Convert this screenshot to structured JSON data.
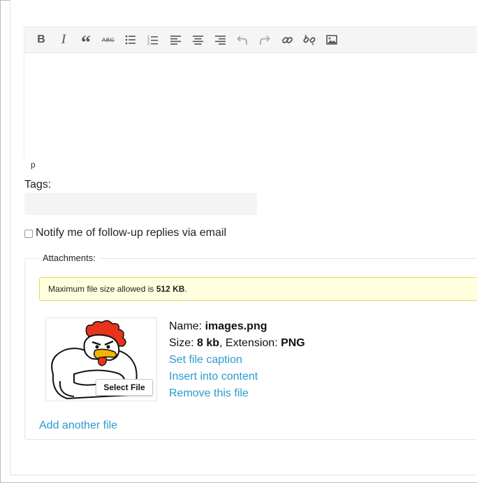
{
  "toolbar": {
    "buttons": [
      {
        "name": "bold",
        "glyph": "B"
      },
      {
        "name": "italic",
        "glyph": "I"
      },
      {
        "name": "blockquote",
        "glyph": "“"
      },
      {
        "name": "strikethrough",
        "glyph": "ABC"
      },
      {
        "name": "bullet-list",
        "icon": "bullet-list-icon"
      },
      {
        "name": "numbered-list",
        "icon": "numbered-list-icon"
      },
      {
        "name": "align-left",
        "icon": "align-left-icon"
      },
      {
        "name": "align-center",
        "icon": "align-center-icon"
      },
      {
        "name": "align-right",
        "icon": "align-right-icon"
      },
      {
        "name": "undo",
        "icon": "undo-icon"
      },
      {
        "name": "redo",
        "icon": "redo-icon"
      },
      {
        "name": "insert-link",
        "icon": "link-icon"
      },
      {
        "name": "remove-link",
        "icon": "unlink-icon"
      },
      {
        "name": "insert-image",
        "icon": "image-icon"
      }
    ]
  },
  "editor": {
    "path": "p"
  },
  "tags": {
    "label": "Tags:",
    "value": ""
  },
  "notify": {
    "label": "Notify me of follow-up replies via email",
    "checked": false
  },
  "attachments": {
    "legend": "Attachments:",
    "notice_prefix": "Maximum file size allowed is ",
    "notice_size": "512 KB",
    "notice_suffix": ".",
    "file": {
      "name_label": "Name: ",
      "name": "images.png",
      "size_label": "Size: ",
      "size": "8 kb",
      "ext_label": ", Extension: ",
      "extension": "PNG",
      "select_label": "Select File",
      "caption_link": "Set file caption",
      "insert_link": "Insert into content",
      "remove_link": "Remove this file"
    },
    "add_link": "Add another file"
  },
  "colors": {
    "link": "#2a9ad1",
    "notice_bg": "#ffffe0",
    "notice_border": "#e6db55",
    "toolbar_bg": "#f5f5f5",
    "rooster_comb": "#e8341c",
    "rooster_beak": "#f4b400"
  }
}
